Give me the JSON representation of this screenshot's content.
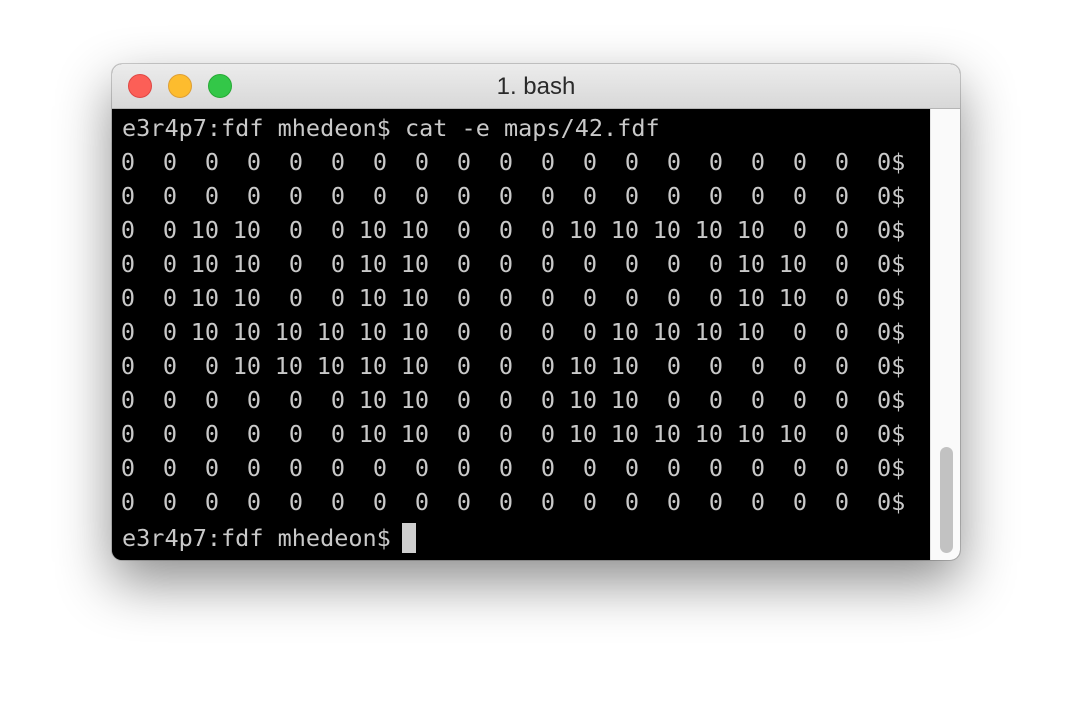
{
  "window": {
    "title": "1. bash",
    "traffic_lights": {
      "close_color": "#fc5f57",
      "minimize_color": "#fdbc2e",
      "maximize_color": "#33c748"
    }
  },
  "terminal": {
    "background_color": "#000000",
    "text_color": "#c9c9c9",
    "command_line": "e3r4p7:fdf mhedeon$ cat -e maps/42.fdf",
    "rows": [
      [
        "0",
        "0",
        "0",
        "0",
        "0",
        "0",
        "0",
        "0",
        "0",
        "0",
        "0",
        "0",
        "0",
        "0",
        "0",
        "0",
        "0",
        "0",
        "0$"
      ],
      [
        "0",
        "0",
        "0",
        "0",
        "0",
        "0",
        "0",
        "0",
        "0",
        "0",
        "0",
        "0",
        "0",
        "0",
        "0",
        "0",
        "0",
        "0",
        "0$"
      ],
      [
        "0",
        "0",
        "10",
        "10",
        "0",
        "0",
        "10",
        "10",
        "0",
        "0",
        "0",
        "10",
        "10",
        "10",
        "10",
        "10",
        "0",
        "0",
        "0$"
      ],
      [
        "0",
        "0",
        "10",
        "10",
        "0",
        "0",
        "10",
        "10",
        "0",
        "0",
        "0",
        "0",
        "0",
        "0",
        "0",
        "10",
        "10",
        "0",
        "0$"
      ],
      [
        "0",
        "0",
        "10",
        "10",
        "0",
        "0",
        "10",
        "10",
        "0",
        "0",
        "0",
        "0",
        "0",
        "0",
        "0",
        "10",
        "10",
        "0",
        "0$"
      ],
      [
        "0",
        "0",
        "10",
        "10",
        "10",
        "10",
        "10",
        "10",
        "0",
        "0",
        "0",
        "0",
        "10",
        "10",
        "10",
        "10",
        "0",
        "0",
        "0$"
      ],
      [
        "0",
        "0",
        "0",
        "10",
        "10",
        "10",
        "10",
        "10",
        "0",
        "0",
        "0",
        "10",
        "10",
        "0",
        "0",
        "0",
        "0",
        "0",
        "0$"
      ],
      [
        "0",
        "0",
        "0",
        "0",
        "0",
        "0",
        "10",
        "10",
        "0",
        "0",
        "0",
        "10",
        "10",
        "0",
        "0",
        "0",
        "0",
        "0",
        "0$"
      ],
      [
        "0",
        "0",
        "0",
        "0",
        "0",
        "0",
        "10",
        "10",
        "0",
        "0",
        "0",
        "10",
        "10",
        "10",
        "10",
        "10",
        "10",
        "0",
        "0$"
      ],
      [
        "0",
        "0",
        "0",
        "0",
        "0",
        "0",
        "0",
        "0",
        "0",
        "0",
        "0",
        "0",
        "0",
        "0",
        "0",
        "0",
        "0",
        "0",
        "0$"
      ],
      [
        "0",
        "0",
        "0",
        "0",
        "0",
        "0",
        "0",
        "0",
        "0",
        "0",
        "0",
        "0",
        "0",
        "0",
        "0",
        "0",
        "0",
        "0",
        "0$"
      ]
    ],
    "prompt": "e3r4p7:fdf mhedeon$ "
  }
}
